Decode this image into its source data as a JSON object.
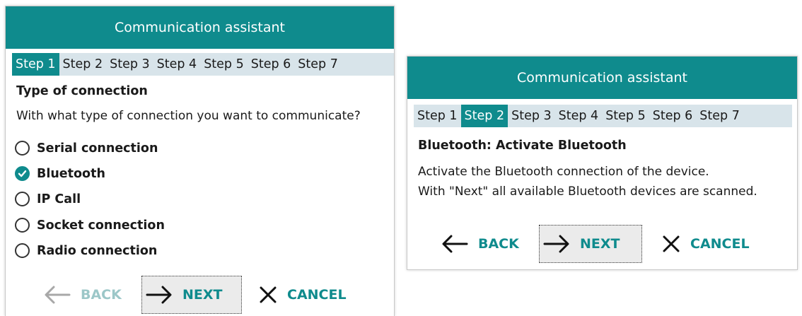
{
  "colors": {
    "accent": "#0f8b8d",
    "step_bar": "#d8e4ea"
  },
  "dialog1": {
    "title": "Communication assistant",
    "steps": [
      "Step 1",
      "Step 2",
      "Step 3",
      "Step 4",
      "Step 5",
      "Step 6",
      "Step 7"
    ],
    "active_step": "Step 1",
    "heading": "Type of connection",
    "question": "With what type of connection you want to communicate?",
    "options": [
      {
        "label": "Serial connection",
        "checked": false
      },
      {
        "label": "Bluetooth",
        "checked": true
      },
      {
        "label": "IP Call",
        "checked": false
      },
      {
        "label": "Socket connection",
        "checked": false
      },
      {
        "label": "Radio connection",
        "checked": false
      }
    ],
    "buttons": {
      "back": "BACK",
      "next": "NEXT",
      "cancel": "CANCEL"
    },
    "icons": {
      "back": "arrow-left-icon",
      "next": "arrow-right-icon",
      "cancel": "close-icon"
    }
  },
  "dialog2": {
    "title": "Communication assistant",
    "steps": [
      "Step 1",
      "Step 2",
      "Step 3",
      "Step 4",
      "Step 5",
      "Step 6",
      "Step 7"
    ],
    "active_step": "Step 2",
    "heading": "Bluetooth: Activate Bluetooth",
    "line1": "Activate the Bluetooth connection of the device.",
    "line2": "With \"Next\" all available Bluetooth devices are scanned.",
    "buttons": {
      "back": "BACK",
      "next": "NEXT",
      "cancel": "CANCEL"
    },
    "icons": {
      "back": "arrow-left-icon",
      "next": "arrow-right-icon",
      "cancel": "close-icon"
    }
  }
}
